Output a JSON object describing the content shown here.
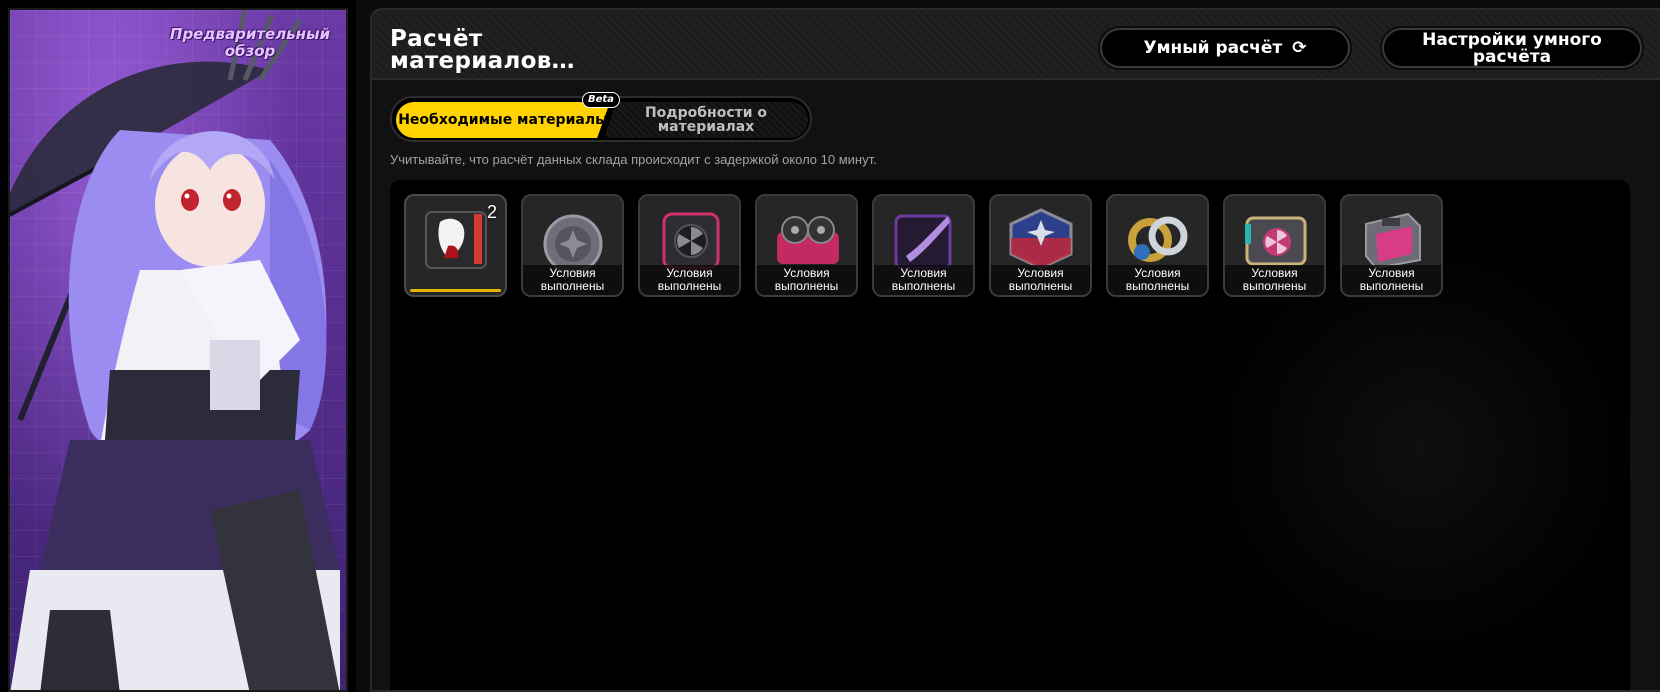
{
  "character": {
    "preview_label": "Предварительный обзор"
  },
  "header": {
    "title": "Расчёт материалов…",
    "smart_calc_label": "Умный расчёт",
    "smart_settings_label": "Настройки умного расчёта"
  },
  "tabs": [
    {
      "label": "Необходимые материалы",
      "active": true
    },
    {
      "label": "Подробности о материалах",
      "active": false
    }
  ],
  "beta_badge": "Beta",
  "notice": "Учитывайте, что расчёт данных склада происходит с задержкой около 10 минут.",
  "materials": [
    {
      "icon": "red-hand-material-icon",
      "quantity": "2",
      "status": ""
    },
    {
      "icon": "silver-disc-material-icon",
      "quantity": "",
      "status": "Условия выполнены"
    },
    {
      "icon": "pink-fan-material-icon",
      "quantity": "",
      "status": "Условия выполнены"
    },
    {
      "icon": "pink-reel-material-icon",
      "quantity": "",
      "status": "Условия выполнены"
    },
    {
      "icon": "purple-blade-material-icon",
      "quantity": "",
      "status": "Условия выполнены"
    },
    {
      "icon": "blue-chip-material-icon",
      "quantity": "",
      "status": "Условия выполнены"
    },
    {
      "icon": "gold-gear-material-icon",
      "quantity": "",
      "status": "Условия выполнены"
    },
    {
      "icon": "fan-module-material-icon",
      "quantity": "",
      "status": "Условия выполнены"
    },
    {
      "icon": "pink-cartridge-material-icon",
      "quantity": "",
      "status": "Условия выполнены"
    }
  ],
  "colors": {
    "accent_yellow": "#ffd200",
    "panel_bg": "#111111",
    "character_bg": "#5a2f93"
  }
}
